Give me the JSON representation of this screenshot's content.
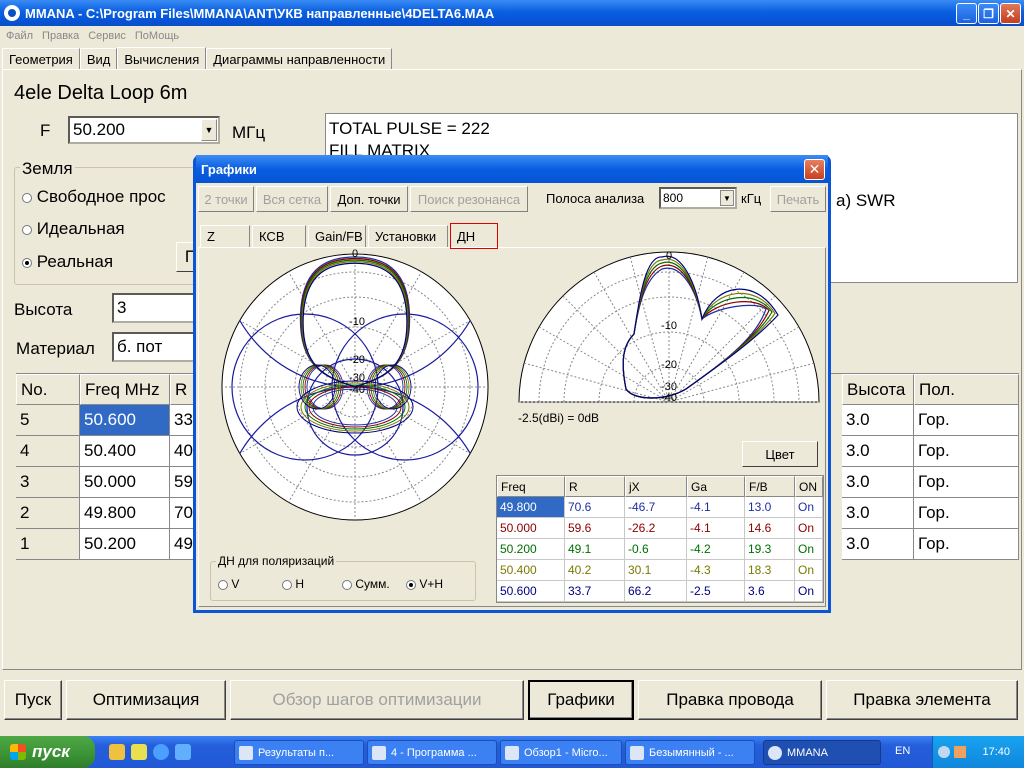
{
  "window": {
    "title": "MMANA - C:\\Program Files\\MMANA\\ANT\\УКВ направленные\\4DELTA6.MAA"
  },
  "menu": [
    "Файл",
    "Правка",
    "Сервис",
    "ПоМощь"
  ],
  "tabs": [
    "Геометрия",
    "Вид",
    "Вычисления",
    "Диаграммы направленности"
  ],
  "antenna_name": "4ele Delta Loop 6m",
  "freq": {
    "label": "F",
    "value": "50.200",
    "unit": "МГц"
  },
  "log": [
    "TOTAL PULSE = 222",
    "FILL MATRIX"
  ],
  "log_tail": "a)  SWR",
  "ground": {
    "label": "Земля",
    "options": [
      "Свободное прос",
      "Идеальная",
      "Реальная"
    ],
    "selected": 2,
    "btn": "П"
  },
  "height": {
    "label": "Высота",
    "value": "3"
  },
  "material": {
    "label": "Материал",
    "value": "б. пот"
  },
  "grid": {
    "headers": [
      "No.",
      "Freq MHz",
      "R"
    ],
    "headers_right": [
      "Высота",
      "Пол."
    ],
    "rows": [
      {
        "no": "5",
        "freq": "50.600",
        "r": "33",
        "h": "3.0",
        "pol": "Гор."
      },
      {
        "no": "4",
        "freq": "50.400",
        "r": "40",
        "h": "3.0",
        "pol": "Гор."
      },
      {
        "no": "3",
        "freq": "50.000",
        "r": "59",
        "h": "3.0",
        "pol": "Гор."
      },
      {
        "no": "2",
        "freq": "49.800",
        "r": "70",
        "h": "3.0",
        "pol": "Гор."
      },
      {
        "no": "1",
        "freq": "50.200",
        "r": "49",
        "h": "3.0",
        "pol": "Гор."
      }
    ]
  },
  "bottom_buttons": [
    "Пуск",
    "Оптимизация",
    "Обзор шагов оптимизации",
    "Графики",
    "Правка провода",
    "Правка элемента"
  ],
  "dialog": {
    "title": "Графики",
    "toolbar": [
      "2 точки",
      "Вся сетка",
      "Доп. точки",
      "Поиск резонанса"
    ],
    "band_label": "Полоса анализа",
    "band_value": "800",
    "band_unit": "кГц",
    "print": "Печать",
    "tabs": [
      "Z",
      "КСВ",
      "Gain/FB",
      "Установки",
      "ДН"
    ],
    "note": "-2.5(dBi) = 0dB",
    "color_btn": "Цвет",
    "polar_labels": {
      "top": "0",
      "r10": "-10",
      "r20": "-20",
      "r30": "-30",
      "r40": "-40"
    },
    "polarization": {
      "label": "ДН для поляризаций",
      "options": [
        "V",
        "H",
        "Сумм.",
        "V+H"
      ],
      "selected": 3
    },
    "table": {
      "headers": [
        "Freq",
        "R",
        "jX",
        "Ga",
        "F/B",
        "ON"
      ],
      "rows": [
        {
          "freq": "49.800",
          "r": "70.6",
          "jx": "-46.7",
          "ga": "-4.1",
          "fb": "13.0",
          "on": "On",
          "color": "#1f2fa0"
        },
        {
          "freq": "50.000",
          "r": "59.6",
          "jx": "-26.2",
          "ga": "-4.1",
          "fb": "14.6",
          "on": "On",
          "color": "#8b0000"
        },
        {
          "freq": "50.200",
          "r": "49.1",
          "jx": "-0.6",
          "ga": "-4.2",
          "fb": "19.3",
          "on": "On",
          "color": "#007000"
        },
        {
          "freq": "50.400",
          "r": "40.2",
          "jx": "30.1",
          "ga": "-4.3",
          "fb": "18.3",
          "on": "On",
          "color": "#7a7a00"
        },
        {
          "freq": "50.600",
          "r": "33.7",
          "jx": "66.2",
          "ga": "-2.5",
          "fb": "3.6",
          "on": "On",
          "color": "#000080"
        }
      ]
    }
  },
  "taskbar": {
    "start": "пуск",
    "tasks": [
      "Результаты п...",
      "4 - Программа ...",
      "Обзор1 - Micro...",
      "Безымянный - ...",
      "MMANA"
    ],
    "lang": "EN",
    "clock": "17:40"
  }
}
